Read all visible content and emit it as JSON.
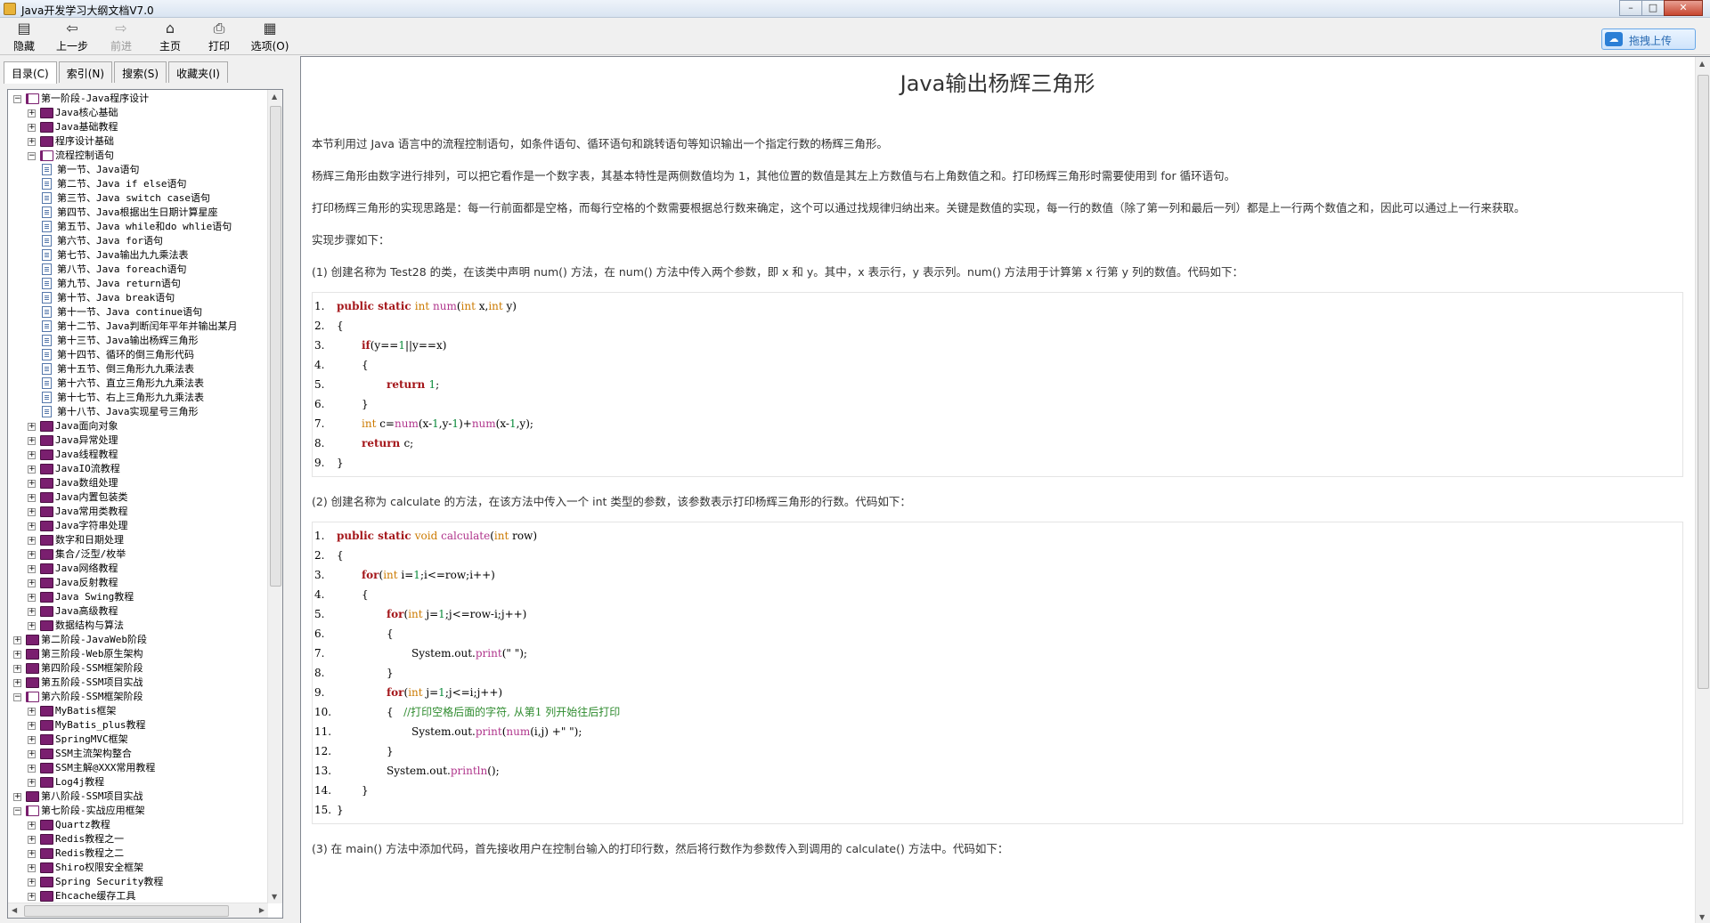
{
  "window": {
    "title": "Java开发学习大纲文档V7.0"
  },
  "toolbar": {
    "buttons": [
      {
        "label": "隐藏",
        "icon": "hide-icon",
        "enabled": true
      },
      {
        "label": "上一步",
        "icon": "back-icon",
        "enabled": true
      },
      {
        "label": "前进",
        "icon": "forward-icon",
        "enabled": false
      },
      {
        "label": "主页",
        "icon": "home-icon",
        "enabled": true
      },
      {
        "label": "打印",
        "icon": "print-icon",
        "enabled": true
      },
      {
        "label": "选项(O)",
        "icon": "options-icon",
        "enabled": true
      }
    ],
    "upload_label": "拖拽上传"
  },
  "tabs": [
    "目录(C)",
    "索引(N)",
    "搜索(S)",
    "收藏夹(I)"
  ],
  "tree": [
    {
      "label": "第一阶段-Java程序设计",
      "level": 0,
      "kind": "book-open",
      "exp": "−"
    },
    {
      "label": "Java核心基础",
      "level": 1,
      "kind": "book",
      "exp": "+"
    },
    {
      "label": "Java基础教程",
      "level": 1,
      "kind": "book",
      "exp": "+"
    },
    {
      "label": "程序设计基础",
      "level": 1,
      "kind": "book",
      "exp": "+"
    },
    {
      "label": "流程控制语句",
      "level": 1,
      "kind": "book-open",
      "exp": "−"
    },
    {
      "label": "第一节、Java语句",
      "level": 2,
      "kind": "page"
    },
    {
      "label": "第二节、Java if else语句",
      "level": 2,
      "kind": "page"
    },
    {
      "label": "第三节、Java switch case语句",
      "level": 2,
      "kind": "page"
    },
    {
      "label": "第四节、Java根据出生日期计算星座",
      "level": 2,
      "kind": "page"
    },
    {
      "label": "第五节、Java while和do whlie语句",
      "level": 2,
      "kind": "page"
    },
    {
      "label": "第六节、Java for语句",
      "level": 2,
      "kind": "page"
    },
    {
      "label": "第七节、Java输出九九乘法表",
      "level": 2,
      "kind": "page"
    },
    {
      "label": "第八节、Java foreach语句",
      "level": 2,
      "kind": "page"
    },
    {
      "label": "第九节、Java return语句",
      "level": 2,
      "kind": "page"
    },
    {
      "label": "第十节、Java break语句",
      "level": 2,
      "kind": "page"
    },
    {
      "label": "第十一节、Java continue语句",
      "level": 2,
      "kind": "page"
    },
    {
      "label": "第十二节、Java判断闰年平年并输出某月",
      "level": 2,
      "kind": "page"
    },
    {
      "label": "第十三节、Java输出杨辉三角形",
      "level": 2,
      "kind": "page"
    },
    {
      "label": "第十四节、循环的倒三角形代码",
      "level": 2,
      "kind": "page"
    },
    {
      "label": "第十五节、倒三角形九九乘法表",
      "level": 2,
      "kind": "page"
    },
    {
      "label": "第十六节、直立三角形九九乘法表",
      "level": 2,
      "kind": "page"
    },
    {
      "label": "第十七节、右上三角形九九乘法表",
      "level": 2,
      "kind": "page"
    },
    {
      "label": "第十八节、Java实现星号三角形",
      "level": 2,
      "kind": "page"
    },
    {
      "label": "Java面向对象",
      "level": 1,
      "kind": "book",
      "exp": "+"
    },
    {
      "label": "Java异常处理",
      "level": 1,
      "kind": "book",
      "exp": "+"
    },
    {
      "label": "Java线程教程",
      "level": 1,
      "kind": "book",
      "exp": "+"
    },
    {
      "label": "JavaIO流教程",
      "level": 1,
      "kind": "book",
      "exp": "+"
    },
    {
      "label": "Java数组处理",
      "level": 1,
      "kind": "book",
      "exp": "+"
    },
    {
      "label": "Java内置包装类",
      "level": 1,
      "kind": "book",
      "exp": "+"
    },
    {
      "label": "Java常用类教程",
      "level": 1,
      "kind": "book",
      "exp": "+"
    },
    {
      "label": "Java字符串处理",
      "level": 1,
      "kind": "book",
      "exp": "+"
    },
    {
      "label": "数字和日期处理",
      "level": 1,
      "kind": "book",
      "exp": "+"
    },
    {
      "label": "集合/泛型/枚举",
      "level": 1,
      "kind": "book",
      "exp": "+"
    },
    {
      "label": "Java网络教程",
      "level": 1,
      "kind": "book",
      "exp": "+"
    },
    {
      "label": "Java反射教程",
      "level": 1,
      "kind": "book",
      "exp": "+"
    },
    {
      "label": "Java Swing教程",
      "level": 1,
      "kind": "book",
      "exp": "+"
    },
    {
      "label": "Java高级教程",
      "level": 1,
      "kind": "book",
      "exp": "+"
    },
    {
      "label": "数据结构与算法",
      "level": 1,
      "kind": "book",
      "exp": "+"
    },
    {
      "label": "第二阶段-JavaWeb阶段",
      "level": 0,
      "kind": "book",
      "exp": "+"
    },
    {
      "label": "第三阶段-Web原生架构",
      "level": 0,
      "kind": "book",
      "exp": "+"
    },
    {
      "label": "第四阶段-SSM框架阶段",
      "level": 0,
      "kind": "book",
      "exp": "+"
    },
    {
      "label": "第五阶段-SSM项目实战",
      "level": 0,
      "kind": "book",
      "exp": "+"
    },
    {
      "label": "第六阶段-SSM框架阶段",
      "level": 0,
      "kind": "book-open",
      "exp": "−"
    },
    {
      "label": "MyBatis框架",
      "level": 1,
      "kind": "book",
      "exp": "+"
    },
    {
      "label": "MyBatis_plus教程",
      "level": 1,
      "kind": "book",
      "exp": "+"
    },
    {
      "label": "SpringMVC框架",
      "level": 1,
      "kind": "book",
      "exp": "+"
    },
    {
      "label": "SSM主流架构整合",
      "level": 1,
      "kind": "book",
      "exp": "+"
    },
    {
      "label": "SSM主解@XXX常用教程",
      "level": 1,
      "kind": "book",
      "exp": "+"
    },
    {
      "label": "Log4j教程",
      "level": 1,
      "kind": "book",
      "exp": "+"
    },
    {
      "label": "第八阶段-SSM项目实战",
      "level": 0,
      "kind": "book",
      "exp": "+"
    },
    {
      "label": "第七阶段-实战应用框架",
      "level": 0,
      "kind": "book-open",
      "exp": "−"
    },
    {
      "label": "Quartz教程",
      "level": 1,
      "kind": "book",
      "exp": "+"
    },
    {
      "label": "Redis教程之一",
      "level": 1,
      "kind": "book",
      "exp": "+"
    },
    {
      "label": "Redis教程之二",
      "level": 1,
      "kind": "book",
      "exp": "+"
    },
    {
      "label": "Shiro权限安全框架",
      "level": 1,
      "kind": "book",
      "exp": "+"
    },
    {
      "label": "Spring Security教程",
      "level": 1,
      "kind": "book",
      "exp": "+"
    },
    {
      "label": "Ehcache缓存工具",
      "level": 1,
      "kind": "book",
      "exp": "+"
    }
  ],
  "article": {
    "title": "Java输出杨辉三角形",
    "paragraphs": [
      "本节利用过 Java 语言中的流程控制语句，如条件语句、循环语句和跳转语句等知识输出一个指定行数的杨辉三角形。",
      "杨辉三角形由数字进行排列，可以把它看作是一个数字表，其基本特性是两侧数值均为 1，其他位置的数值是其左上方数值与右上角数值之和。打印杨辉三角形时需要使用到 for 循环语句。",
      "打印杨辉三角形的实现思路是：每一行前面都是空格，而每行空格的个数需要根据总行数来确定，这个可以通过找规律归纳出来。关键是数值的实现，每一行的数值（除了第一列和最后一列）都是上一行两个数值之和，因此可以通过上一行来获取。",
      "实现步骤如下："
    ],
    "step1": "(1) 创建名称为 Test28 的类，在该类中声明 num() 方法，在 num() 方法中传入两个参数，即 x 和 y。其中，x 表示行，y 表示列。num() 方法用于计算第 x 行第 y 列的数值。代码如下：",
    "code1": [
      {
        "n": "1.",
        "indent": 0,
        "tokens": [
          [
            "kw",
            "public static "
          ],
          [
            "ty",
            "int "
          ],
          [
            "fn",
            "num"
          ],
          [
            "",
            "("
          ],
          [
            "ty",
            "int "
          ],
          [
            "",
            "x,"
          ],
          [
            "ty",
            "int "
          ],
          [
            "",
            "y)"
          ]
        ]
      },
      {
        "n": "2.",
        "indent": 0,
        "tokens": [
          [
            "",
            "{"
          ]
        ]
      },
      {
        "n": "3.",
        "indent": 1,
        "tokens": [
          [
            "kw",
            "if"
          ],
          [
            "",
            "("
          ],
          [
            "",
            "y"
          ],
          [
            "",
            "=="
          ],
          [
            "nm",
            "1"
          ],
          [
            "",
            "||"
          ],
          [
            "",
            "y"
          ],
          [
            "",
            "=="
          ],
          [
            "",
            "x)"
          ]
        ]
      },
      {
        "n": "4.",
        "indent": 1,
        "tokens": [
          [
            "",
            "{"
          ]
        ]
      },
      {
        "n": "5.",
        "indent": 2,
        "tokens": [
          [
            "kw",
            "return "
          ],
          [
            "nm",
            "1"
          ],
          [
            "",
            ";"
          ]
        ]
      },
      {
        "n": "6.",
        "indent": 1,
        "tokens": [
          [
            "",
            "}"
          ]
        ]
      },
      {
        "n": "7.",
        "indent": 1,
        "tokens": [
          [
            "ty",
            "int "
          ],
          [
            "",
            "c="
          ],
          [
            "fn",
            "num"
          ],
          [
            "",
            "(x-"
          ],
          [
            "nm",
            "1"
          ],
          [
            "",
            ",y-"
          ],
          [
            "nm",
            "1"
          ],
          [
            "",
            ")+"
          ],
          [
            "fn",
            "num"
          ],
          [
            "",
            "(x-"
          ],
          [
            "nm",
            "1"
          ],
          [
            "",
            ",y);"
          ]
        ]
      },
      {
        "n": "8.",
        "indent": 1,
        "tokens": [
          [
            "kw",
            "return "
          ],
          [
            "",
            "c;"
          ]
        ]
      },
      {
        "n": "9.",
        "indent": 0,
        "tokens": [
          [
            "",
            "}"
          ]
        ]
      }
    ],
    "step2": "(2) 创建名称为 calculate 的方法，在该方法中传入一个 int 类型的参数，该参数表示打印杨辉三角形的行数。代码如下：",
    "code2": [
      {
        "n": "1.",
        "indent": 0,
        "tokens": [
          [
            "kw",
            "public static "
          ],
          [
            "ty",
            "void "
          ],
          [
            "fn",
            "calculate"
          ],
          [
            "",
            "("
          ],
          [
            "ty",
            "int "
          ],
          [
            "",
            "row)"
          ]
        ]
      },
      {
        "n": "2.",
        "indent": 0,
        "tokens": [
          [
            "",
            "{"
          ]
        ]
      },
      {
        "n": "3.",
        "indent": 1,
        "tokens": [
          [
            "kw",
            "for"
          ],
          [
            "",
            "("
          ],
          [
            "ty",
            "int "
          ],
          [
            "",
            "i="
          ],
          [
            "nm",
            "1"
          ],
          [
            "",
            ";i<=row;i++)"
          ]
        ]
      },
      {
        "n": "4.",
        "indent": 1,
        "tokens": [
          [
            "",
            "{"
          ]
        ]
      },
      {
        "n": "5.",
        "indent": 2,
        "tokens": [
          [
            "kw",
            "for"
          ],
          [
            "",
            "("
          ],
          [
            "ty",
            "int "
          ],
          [
            "",
            "j="
          ],
          [
            "nm",
            "1"
          ],
          [
            "",
            ";j<=row-i;j++)"
          ]
        ]
      },
      {
        "n": "6.",
        "indent": 2,
        "tokens": [
          [
            "",
            "{"
          ]
        ]
      },
      {
        "n": "7.",
        "indent": 3,
        "tokens": [
          [
            "",
            "System.out."
          ],
          [
            "fn",
            "print"
          ],
          [
            "",
            "(\" \");"
          ]
        ]
      },
      {
        "n": "8.",
        "indent": 2,
        "tokens": [
          [
            "",
            "}"
          ]
        ]
      },
      {
        "n": "9.",
        "indent": 2,
        "tokens": [
          [
            "kw",
            "for"
          ],
          [
            "",
            "("
          ],
          [
            "ty",
            "int "
          ],
          [
            "",
            "j="
          ],
          [
            "nm",
            "1"
          ],
          [
            "",
            ";j<=i;j++)"
          ]
        ]
      },
      {
        "n": "10.",
        "indent": 2,
        "tokens": [
          [
            "",
            "{   "
          ],
          [
            "cm",
            "//打印空格后面的字符, 从第1 列开始往后打印"
          ]
        ]
      },
      {
        "n": "11.",
        "indent": 3,
        "tokens": [
          [
            "",
            "System.out."
          ],
          [
            "fn",
            "print"
          ],
          [
            "",
            "("
          ],
          [
            "fn",
            "num"
          ],
          [
            "",
            "(i,j) +\" \");"
          ]
        ]
      },
      {
        "n": "12.",
        "indent": 2,
        "tokens": [
          [
            "",
            "}"
          ]
        ]
      },
      {
        "n": "13.",
        "indent": 2,
        "tokens": [
          [
            "",
            "System.out."
          ],
          [
            "fn",
            "println"
          ],
          [
            "",
            "();"
          ]
        ]
      },
      {
        "n": "14.",
        "indent": 1,
        "tokens": [
          [
            "",
            "}"
          ]
        ]
      },
      {
        "n": "15.",
        "indent": 0,
        "tokens": [
          [
            "",
            "}"
          ]
        ]
      }
    ],
    "step3": "(3) 在 main() 方法中添加代码，首先接收用户在控制台输入的打印行数，然后将行数作为参数传入到调用的 calculate() 方法中。代码如下："
  }
}
